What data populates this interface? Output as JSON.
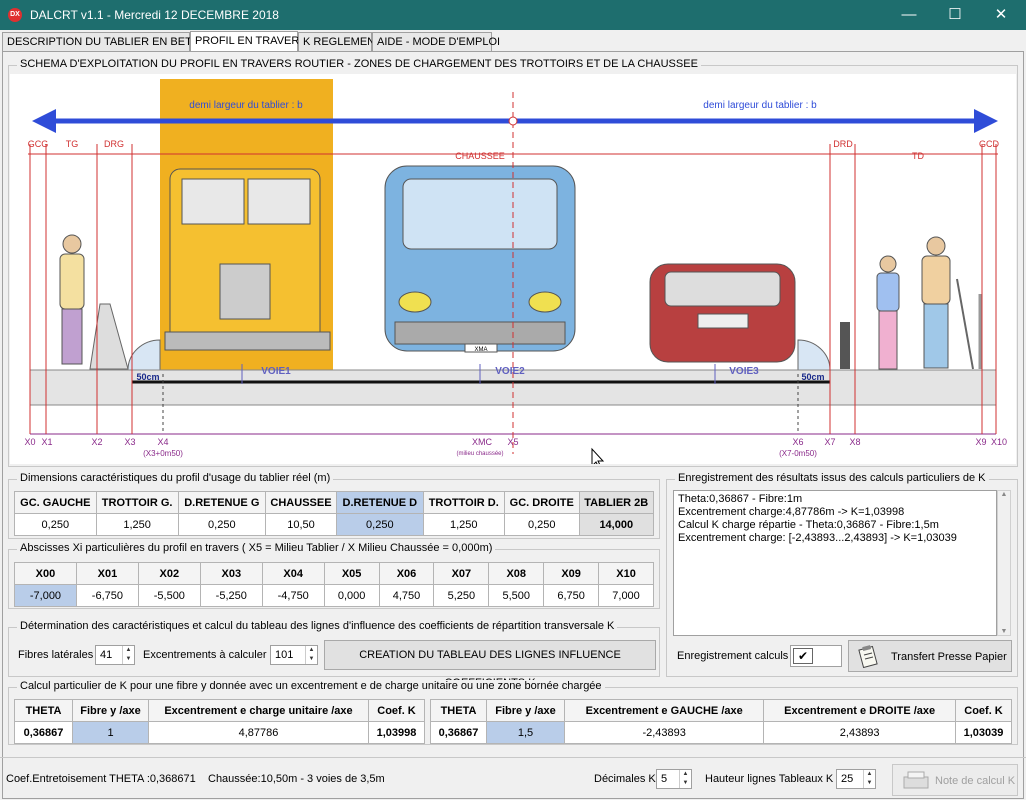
{
  "window": {
    "title": "DALCRT v1.1 - Mercredi 12 DECEMBRE 2018",
    "icon": "dalcrt-app-icon",
    "minimize": "—",
    "maximize": "☐",
    "close": "✕"
  },
  "tabs": [
    "DESCRIPTION DU TABLIER EN BETON",
    "PROFIL EN TRAVERS",
    "K REGLEMENT",
    "AIDE - MODE D'EMPLOI"
  ],
  "schema": {
    "title": "SCHEMA D'EXPLOITATION DU PROFIL EN TRAVERS ROUTIER - ZONES DE CHARGEMENT DES TROTTOIRS ET DE LA CHAUSSEE",
    "half_width_left": "demi largeur du tablier : b",
    "half_width_right": "demi largeur du tablier : b",
    "zone_labels": [
      "GCG",
      "TG",
      "DRG",
      "CHAUSSEE",
      "DRD",
      "TD",
      "GCD"
    ],
    "lanes": [
      "VOIE1",
      "VOIE2",
      "VOIE3"
    ],
    "margin_left": "50cm",
    "margin_right": "50cm",
    "abscissa_labels": [
      "X0",
      "X1",
      "X2",
      "X3",
      "X4",
      "XMC",
      "X5",
      "X6",
      "X7",
      "X8",
      "X9",
      "X10"
    ],
    "x4_note": "(X3+0m50)",
    "xmc_note": "(milieu chaussée)",
    "x6_note": "(X7-0m50)",
    "truck_label": "truck-illustration",
    "van_label": "van-illustration",
    "car_label": "car-illustration",
    "van_plate": "XMA",
    "colors": {
      "accent": "#2f4cd8",
      "zone": "#d03030",
      "truck": "#f0b020",
      "lane": "#6060c0",
      "marker": "#8a2a8a"
    }
  },
  "dimensions": {
    "legend": "Dimensions caractéristiques du profil d'usage du tablier réel (m)",
    "headers": [
      "GC. GAUCHE",
      "TROTTOIR G.",
      "D.RETENUE G",
      "CHAUSSEE",
      "D.RETENUE D",
      "TROTTOIR D.",
      "GC. DROITE",
      "TABLIER 2B"
    ],
    "values": [
      "0,250",
      "1,250",
      "0,250",
      "10,50",
      "0,250",
      "1,250",
      "0,250",
      "14,000"
    ]
  },
  "abscissas": {
    "legend": "Abscisses Xi particulières du profil en travers ( X5 = Milieu Tablier / X Milieu Chaussée = 0,000m)",
    "headers": [
      "X00",
      "X01",
      "X02",
      "X03",
      "X04",
      "X05",
      "X06",
      "X07",
      "X08",
      "X09",
      "X10"
    ],
    "values": [
      "-7,000",
      "-6,750",
      "-5,500",
      "-5,250",
      "-4,750",
      "0,000",
      "4,750",
      "5,250",
      "5,500",
      "6,750",
      "7,000"
    ]
  },
  "influence": {
    "legend": "Détermination des caractéristiques et calcul du tableau des lignes d'influence des coefficients de répartition transversale K",
    "fibers_label": "Fibres latérales",
    "fibers_value": "41",
    "eccentricities_label": "Excentrements à calculer",
    "eccentricities_value": "101",
    "create_button": "CREATION DU TABLEAU DES LIGNES INFLUENCE COEFFICIENTS K"
  },
  "results": {
    "legend": "Enregistrement des résultats issus des calculs particuliers de K",
    "lines": [
      "Theta:0,36867 - Fibre:1m",
      "Excentrement charge:4,87786m -> K=1,03998",
      "Calcul K charge répartie - Theta:0,36867 - Fibre:1,5m",
      "Excentrement charge: [-2,43893...2,43893] -> K=1,03039"
    ],
    "record_label": "Enregistrement calculs",
    "transfer_button": "Transfert Presse Papier"
  },
  "particular": {
    "legend": "Calcul particulier de K pour une fibre y donnée avec un excentrement e de charge unitaire ou une zone bornée chargée",
    "left_headers": [
      "THETA",
      "Fibre y /axe",
      "Excentrement e charge unitaire /axe",
      "Coef. K"
    ],
    "left_values": [
      "0,36867",
      "1",
      "4,87786",
      "1,03998"
    ],
    "right_headers": [
      "THETA",
      "Fibre y /axe",
      "Excentrement e GAUCHE /axe",
      "Excentrement e DROITE /axe",
      "Coef. K"
    ],
    "right_values": [
      "0,36867",
      "1,5",
      "-2,43893",
      "2,43893",
      "1,03039"
    ]
  },
  "status": {
    "theta": "Coef.Entretoisement THETA :0,368671",
    "chaussee": "Chaussée:10,50m - 3 voies de 3,5m",
    "decimals_label": "Décimales K",
    "decimals_value": "5",
    "row_height_label": "Hauteur lignes Tableaux K",
    "row_height_value": "25",
    "note_button": "Note de calcul K"
  }
}
